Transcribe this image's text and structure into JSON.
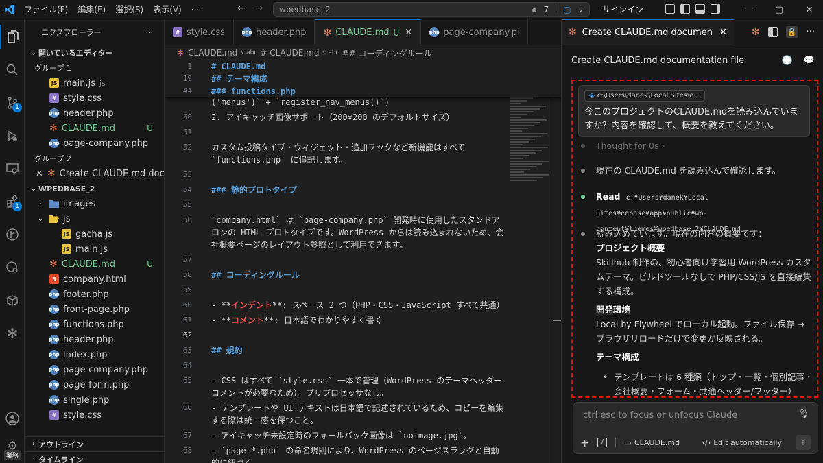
{
  "menu": [
    "ファイル(F)",
    "編集(E)",
    "選択(S)",
    "表示(V)",
    "···"
  ],
  "command_center": {
    "text": "wpedbase_2",
    "count": "7"
  },
  "signin": "サインイン",
  "activity_badges": {
    "scm": "1",
    "extensions": "1"
  },
  "account_tag": "業務",
  "explorer": {
    "title": "エクスプローラー",
    "open_editors": "開いているエディター",
    "group1": "グループ 1",
    "group2": "グループ 2",
    "open_files": [
      {
        "name": "main.js",
        "suffix": "js",
        "icon": "js"
      },
      {
        "name": "style.css",
        "icon": "css"
      },
      {
        "name": "header.php",
        "icon": "php"
      },
      {
        "name": "CLAUDE.md",
        "icon": "claude",
        "git": "U"
      },
      {
        "name": "page-company.php",
        "icon": "php"
      }
    ],
    "group2_file": "Create CLAUDE.md doc...",
    "project": "WPEDBASE_2",
    "tree": [
      {
        "name": "images",
        "icon": "folder",
        "depth": 1,
        "chev": "›"
      },
      {
        "name": "js",
        "icon": "folder-open",
        "depth": 1,
        "chev": "⌄"
      },
      {
        "name": "gacha.js",
        "icon": "js",
        "depth": 2
      },
      {
        "name": "main.js",
        "icon": "js",
        "depth": 2
      },
      {
        "name": "CLAUDE.md",
        "icon": "claude",
        "depth": 1,
        "git": "U"
      },
      {
        "name": "company.html",
        "icon": "html",
        "depth": 1
      },
      {
        "name": "footer.php",
        "icon": "php",
        "depth": 1
      },
      {
        "name": "front-page.php",
        "icon": "php",
        "depth": 1
      },
      {
        "name": "functions.php",
        "icon": "php",
        "depth": 1
      },
      {
        "name": "header.php",
        "icon": "php",
        "depth": 1
      },
      {
        "name": "index.php",
        "icon": "php",
        "depth": 1
      },
      {
        "name": "page-company.php",
        "icon": "php",
        "depth": 1
      },
      {
        "name": "page-form.php",
        "icon": "php",
        "depth": 1
      },
      {
        "name": "single.php",
        "icon": "php",
        "depth": 1
      },
      {
        "name": "style.css",
        "icon": "css",
        "depth": 1
      }
    ],
    "outline": "アウトライン",
    "timeline": "タイムライン"
  },
  "tabs": [
    {
      "label": "style.css",
      "icon": "css"
    },
    {
      "label": "header.php",
      "icon": "php"
    },
    {
      "label": "CLAUDE.md",
      "icon": "claude",
      "git": "U",
      "active": true
    },
    {
      "label": "page-company.pl",
      "icon": "php"
    }
  ],
  "breadcrumb": [
    "CLAUDE.md",
    "# CLAUDE.md",
    "## コーディングルール"
  ],
  "sticky": [
    {
      "n": "1",
      "t": "# CLAUDE.md"
    },
    {
      "n": "19",
      "t": "## テーマ構成"
    },
    {
      "n": "44",
      "t": "### functions.php"
    }
  ],
  "lines": [
    {
      "n": "",
      "t": "('menus')` + `register_nav_menus()`)"
    },
    {
      "n": "50",
      "t": "2. アイキャッチ画像サポート（200×200 のデフォルトサイズ）"
    },
    {
      "n": "51",
      "t": ""
    },
    {
      "n": "52",
      "t": "カスタム投稿タイプ・ウィジェット・追加フックなど新機能はすべて `functions.php` に追記します。"
    },
    {
      "n": "53",
      "t": ""
    },
    {
      "n": "54",
      "t": "### 静的プロトタイプ"
    },
    {
      "n": "55",
      "t": ""
    },
    {
      "n": "56",
      "t": "`company.html` は `page-company.php` 開発時に使用したスタンドアロンの HTML プロトタイプです。WordPress からは読み込まれないため、会社概要ページのレイアウト参照として利用できます。"
    },
    {
      "n": "57",
      "t": ""
    },
    {
      "n": "58",
      "t": "## コーディングルール"
    },
    {
      "n": "59",
      "t": ""
    },
    {
      "n": "60",
      "t": "- **インデント**: スペース 2 つ（PHP・CSS・JavaScript すべて共通）"
    },
    {
      "n": "61",
      "t": "- **コメント**: 日本語でわかりやすく書く"
    },
    {
      "n": "62",
      "t": ""
    },
    {
      "n": "63",
      "t": "## 規約"
    },
    {
      "n": "64",
      "t": ""
    },
    {
      "n": "65",
      "t": "- CSS はすべて `style.css` 一本で管理（WordPress のテーマヘッダーコメントが必要なため）。プリプロセッサなし。"
    },
    {
      "n": "66",
      "t": "- テンプレートや UI テキストは日本語で記述されているため、コピーを編集する際は統一感を保つこと。"
    },
    {
      "n": "67",
      "t": "- アイキャッチ未設定時のフォールバック画像は `noimage.jpg`。"
    },
    {
      "n": "68",
      "t": "- `page-*.php` の命名規則により、WordPress のページスラッグと自動的に紐づく。"
    },
    {
      "n": "69",
      "t": ""
    }
  ],
  "panel": {
    "tab": "Create CLAUDE.md documen",
    "title": "Create CLAUDE.md documentation file",
    "context_chip": "c:\\Users\\danek\\Local Sites\\e...",
    "user_message": "今このプロジェクトのCLAUDE.mdを読み込んでいますか？内容を確認して、概要を教えてください。",
    "thought": "Thought for 0s ›",
    "step1": "現在の CLAUDE.md を読み込んで確認します。",
    "read_label": "Read",
    "read_path": "c:¥Users¥danek¥Local Sites¥edbase¥app¥public¥wp-content¥themes¥wpedbase_2¥CLAUDE.md",
    "summary_intro": "読み込めています。現在の内容の概要です：",
    "h1": "プロジェクト概要",
    "p1": "Skillhub 制作の、初心者向け学習用 WordPress カスタムテーマ。ビルドツールなしで PHP/CSS/JS を直接編集する構成。",
    "h2": "開発環境",
    "p2": "Local by Flywheel でローカル起動。ファイル保存 → ブラウザリロードだけで変更が反映される。",
    "h3": "テーマ構成",
    "bullet": "テンプレートは 6 種類（トップ・一覧・個別記事・会社概要・フォーム・共通ヘッダー/フッター）",
    "input_placeholder": "ctrl esc to focus or unfocus Claude",
    "file_chip": "CLAUDE.md",
    "mode": "Edit automatically"
  }
}
